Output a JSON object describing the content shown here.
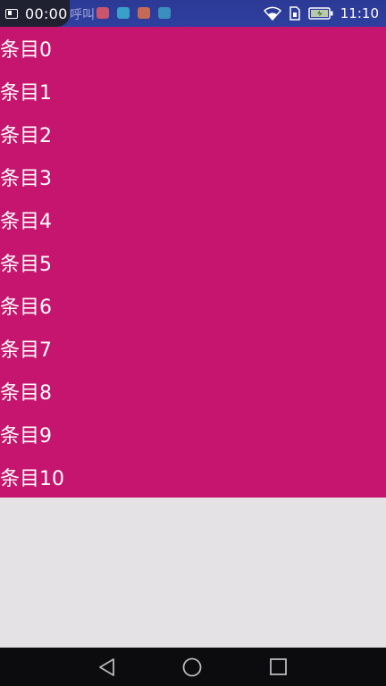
{
  "status_bar": {
    "timer": "00:00",
    "notification_text": "呼叫",
    "time": "11:10",
    "notif_icons": [
      {
        "name": "video-app-icon",
        "color": "#c9546b"
      },
      {
        "name": "browser-app-icon",
        "color": "#3aa0c8"
      },
      {
        "name": "heart-app-icon",
        "color": "#c46a55"
      },
      {
        "name": "chat-app-icon",
        "color": "#3b8fc0"
      }
    ],
    "colors": {
      "background": "#2f3f9f",
      "timer_pill": "#1f2030"
    }
  },
  "list": {
    "background": "#c5156e",
    "items": [
      {
        "label": "条目0"
      },
      {
        "label": "条目1"
      },
      {
        "label": "条目2"
      },
      {
        "label": "条目3"
      },
      {
        "label": "条目4"
      },
      {
        "label": "条目5"
      },
      {
        "label": "条目6"
      },
      {
        "label": "条目7"
      },
      {
        "label": "条目8"
      },
      {
        "label": "条目9"
      },
      {
        "label": "条目10"
      }
    ]
  },
  "nav_bar": {
    "buttons": [
      {
        "name": "back-icon"
      },
      {
        "name": "home-icon"
      },
      {
        "name": "recents-icon"
      }
    ]
  }
}
